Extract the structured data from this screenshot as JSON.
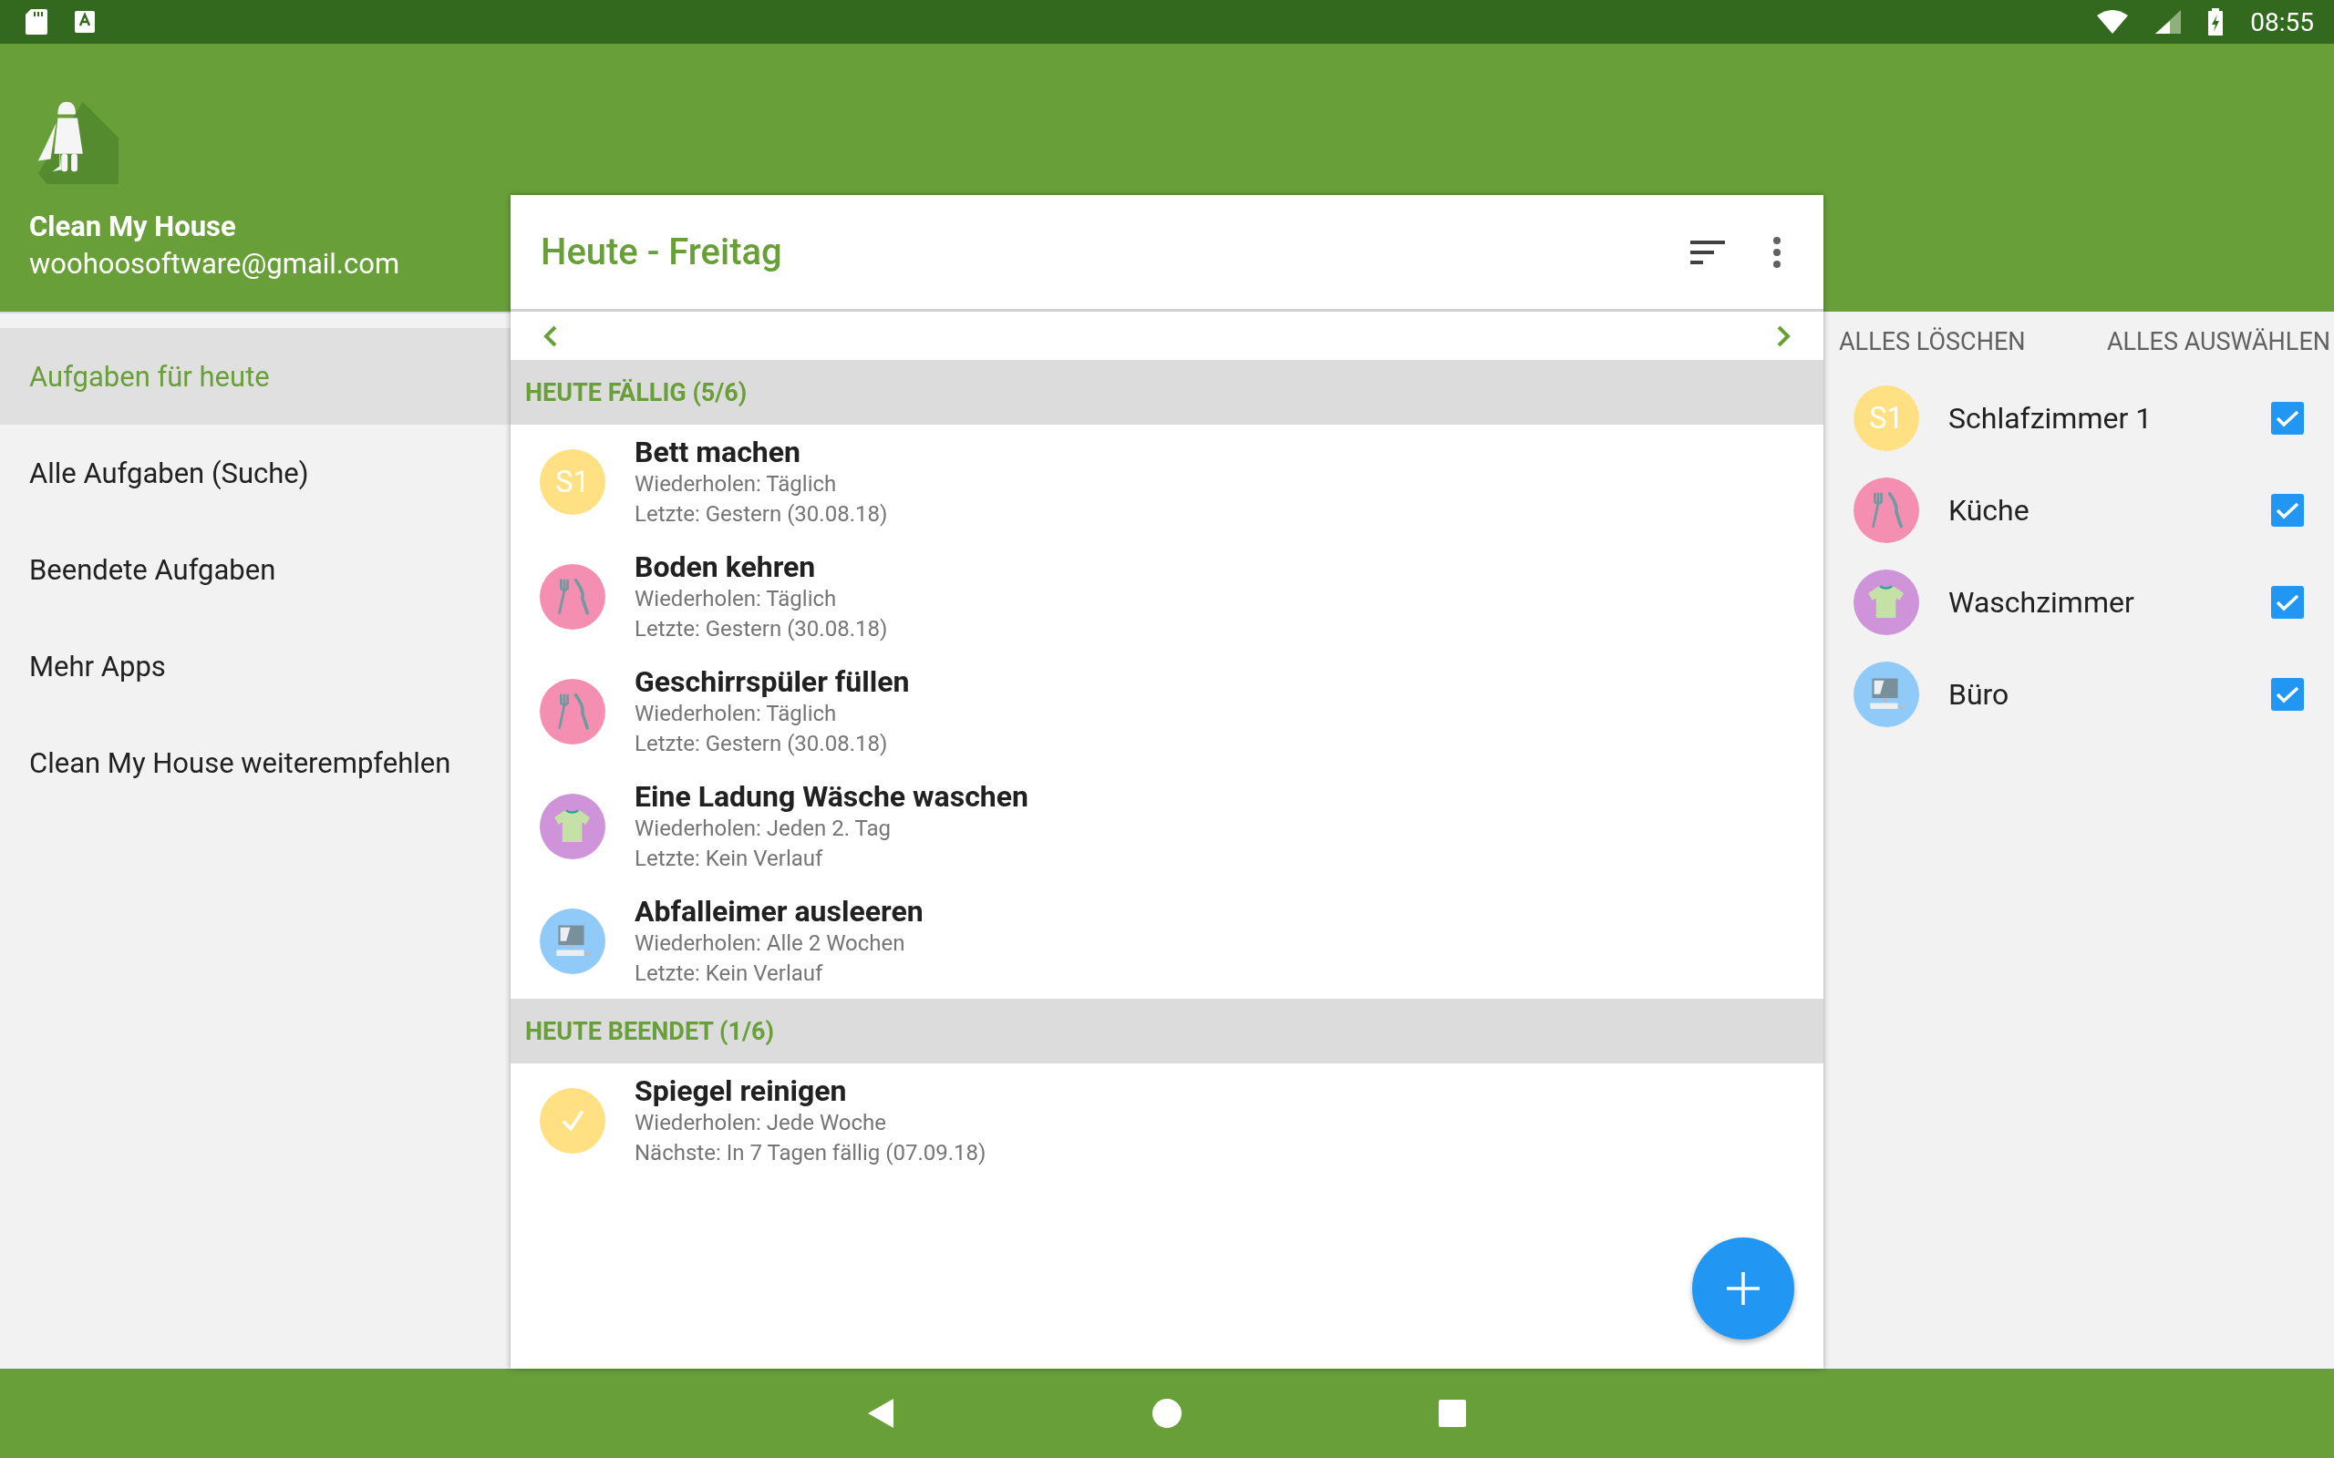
{
  "status_bar": {
    "time": "08:55"
  },
  "drawer": {
    "app_name": "Clean My House",
    "email": "woohoosoftware@gmail.com",
    "items": [
      {
        "label": "Aufgaben für heute",
        "selected": true
      },
      {
        "label": "Alle Aufgaben (Suche)",
        "selected": false
      },
      {
        "label": "Beendete Aufgaben",
        "selected": false
      },
      {
        "label": "Mehr Apps",
        "selected": false
      },
      {
        "label": "Clean My House weiterempfehlen",
        "selected": false
      }
    ]
  },
  "card": {
    "title": "Heute - Freitag",
    "sections": [
      {
        "title": "HEUTE FÄLLIG (5/6)",
        "tasks": [
          {
            "title": "Bett machen",
            "repeat": "Wiederholen: Täglich",
            "detail": "Letzte: Gestern (30.08.18)",
            "icon": {
              "kind": "initials",
              "text": "S1"
            },
            "color": "#ffe082"
          },
          {
            "title": "Boden kehren",
            "repeat": "Wiederholen: Täglich",
            "detail": "Letzte: Gestern (30.08.18)",
            "icon": {
              "kind": "cutlery"
            },
            "color": "#f48fb1"
          },
          {
            "title": "Geschirrspüler füllen",
            "repeat": "Wiederholen: Täglich",
            "detail": "Letzte: Gestern (30.08.18)",
            "icon": {
              "kind": "cutlery"
            },
            "color": "#f48fb1"
          },
          {
            "title": "Eine Ladung Wäsche waschen",
            "repeat": "Wiederholen: Jeden 2. Tag",
            "detail": "Letzte: Kein Verlauf",
            "icon": {
              "kind": "shirt"
            },
            "color": "#ce93d8"
          },
          {
            "title": "Abfalleimer ausleeren",
            "repeat": "Wiederholen: Alle 2 Wochen",
            "detail": "Letzte: Kein Verlauf",
            "icon": {
              "kind": "computer"
            },
            "color": "#90caf9"
          }
        ]
      },
      {
        "title": "HEUTE BEENDET (1/6)",
        "tasks": [
          {
            "title": "Spiegel reinigen",
            "repeat": "Wiederholen: Jede Woche",
            "detail": "Nächste: In 7 Tagen fällig (07.09.18)",
            "icon": {
              "kind": "check"
            },
            "color": "#ffe082"
          }
        ]
      }
    ]
  },
  "rooms": {
    "actions": [
      "ALLES LÖSCHEN",
      "ALLES AUSWÄHLEN"
    ],
    "items": [
      {
        "name": "Schlafzimmer 1",
        "icon": {
          "kind": "initials",
          "text": "S1"
        },
        "color": "#ffe082",
        "checked": true
      },
      {
        "name": "Küche",
        "icon": {
          "kind": "cutlery"
        },
        "color": "#f48fb1",
        "checked": true
      },
      {
        "name": "Waschzimmer",
        "icon": {
          "kind": "shirt"
        },
        "color": "#ce93d8",
        "checked": true
      },
      {
        "name": "Büro",
        "icon": {
          "kind": "computer"
        },
        "color": "#90caf9",
        "checked": true
      }
    ]
  }
}
